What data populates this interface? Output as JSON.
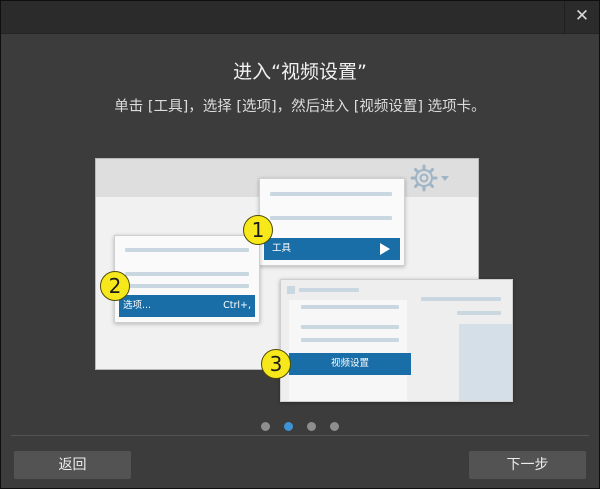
{
  "dialog": {
    "close_glyph": "✕",
    "heading": "进入“视频设置”",
    "instruction": "单击 [工具]，选择 [选项]，然后进入 [视频设置] 选项卡。"
  },
  "illustration": {
    "step1": {
      "number": "1",
      "menu_label": "工具"
    },
    "step2": {
      "number": "2",
      "menu_label": "选项...",
      "shortcut": "Ctrl+,"
    },
    "step3": {
      "number": "3",
      "tab_label": "视频设置"
    },
    "toolbar_icons": [
      "gear-icon",
      "dropdown-caret-icon",
      "play-icon"
    ]
  },
  "pagination": {
    "total": 4,
    "active_index": 1
  },
  "footer": {
    "back_label": "返回",
    "next_label": "下一步"
  },
  "colors": {
    "accent": "#1a6ea7",
    "badge": "#f7e81b",
    "active_dot": "#3d93d4",
    "dialog_bg": "#3c3c3c"
  }
}
